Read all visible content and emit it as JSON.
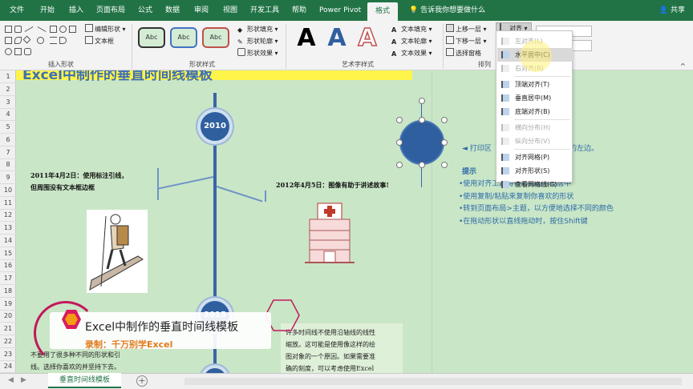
{
  "tabs": [
    "文件",
    "开始",
    "插入",
    "页面布局",
    "公式",
    "数据",
    "审阅",
    "视图",
    "开发工具",
    "帮助",
    "Power Pivot",
    "格式"
  ],
  "tell_me": "告诉我你想要做什么",
  "share": "共享",
  "ribbon": {
    "insert_shapes": {
      "edit_shape": "编辑形状",
      "text_box": "文本框",
      "label": "插入形状"
    },
    "shape_styles": {
      "preset": "Abc",
      "fill": "形状填充",
      "outline": "形状轮廓",
      "effects": "形状效果",
      "label": "形状样式"
    },
    "wordart": {
      "glyph": "A",
      "text_fill": "文本填充",
      "text_outline": "文本轮廓",
      "text_effects": "文本效果",
      "label": "艺术字样式"
    },
    "arrange": {
      "bring_forward": "上移一层",
      "send_backward": "下移一层",
      "selection_pane": "选择窗格",
      "align": "对齐",
      "label": "排列"
    }
  },
  "align_menu": [
    {
      "label": "左对齐(L)",
      "disabled": true
    },
    {
      "label": "水平居中(C)",
      "disabled": false,
      "hover": true
    },
    {
      "label": "右对齐(R)",
      "disabled": true
    },
    {
      "label": "顶端对齐(T)",
      "disabled": false
    },
    {
      "label": "垂直居中(M)",
      "disabled": false
    },
    {
      "label": "底端对齐(B)",
      "disabled": false
    },
    {
      "label": "横向分布(H)",
      "disabled": true
    },
    {
      "label": "纵向分布(V)",
      "disabled": true
    },
    {
      "label": "对齐网格(P)",
      "disabled": false
    },
    {
      "label": "对齐形状(S)",
      "disabled": false
    },
    {
      "label": "查看网格线(G)",
      "disabled": false
    }
  ],
  "rows": [
    "1",
    "2",
    "3",
    "4",
    "5",
    "6",
    "7",
    "8",
    "9",
    "10",
    "11",
    "12",
    "13",
    "14",
    "15",
    "16",
    "17",
    "18",
    "19",
    "20",
    "21",
    "22",
    "23",
    "24"
  ],
  "sheet": {
    "title": "Excel中制作的垂直时间线模板",
    "years": [
      "2010",
      "2015"
    ],
    "event1": [
      "2011年4月2日：使用标注引线，",
      "但周围没有文本框边框"
    ],
    "event2": "2012年4月5日：图像有助于讲述故事!",
    "notes": {
      "print_hint": "◄ 打印区",
      "print_hint_tail": "的左边。",
      "tips_head": "提示",
      "tips": [
        "•使用对齐工具将很形和图形签居中",
        "•使用复制/粘贴来复制你喜欢的形状",
        "•转到页面布局>主题，以方便地选择不同的颜色",
        "•在拖动形状以直线拖动时，按住Shift键"
      ]
    },
    "bottom_left": [
      "不要用了很多种不同的形状和引",
      "线。选择你喜欢的并坚持下去。"
    ],
    "bottom_right": [
      "许多时间线不使用沿轴线的线性",
      "缩放。这可能是使用像这样的绘",
      "图对象的一个原因。如果需要准",
      "确的刻度，可以考虑使用Excel"
    ]
  },
  "watermark": {
    "line1": "Excel中制作的垂直时间线模板",
    "line2": "录制：千万别学Excel"
  },
  "sheet_tab": "垂直时间线模板",
  "colors": {
    "excel_green": "#217346",
    "timeline_blue": "#2f5f9f",
    "sheet_bg": "#c9e6c6",
    "title_yellow": "#fff44a"
  }
}
